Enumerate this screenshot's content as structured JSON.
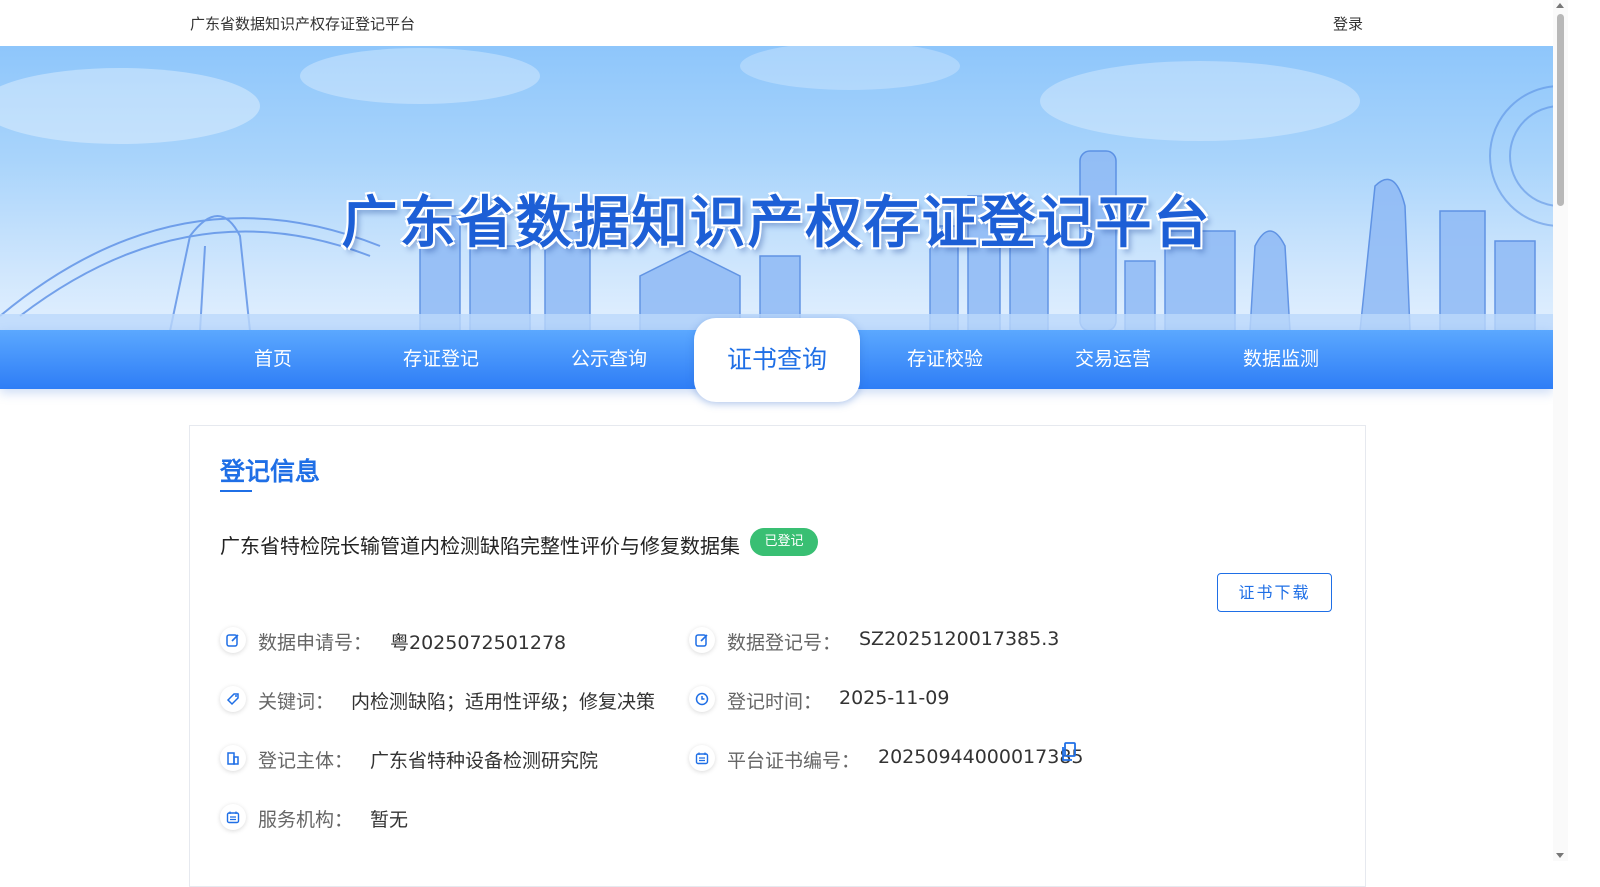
{
  "header": {
    "site_title": "广东省数据知识产权存证登记平台",
    "login_label": "登录"
  },
  "banner": {
    "title": "广东省数据知识产权存证登记平台"
  },
  "nav": {
    "items": [
      "首页",
      "存证登记",
      "公示查询",
      "证书查询",
      "存证校验",
      "交易运营",
      "数据监测"
    ],
    "active": "证书查询"
  },
  "record": {
    "section_title": "登记信息",
    "name": "广东省特检院长输管道内检测缺陷完整性评价与修复数据集",
    "status_badge": "已登记",
    "download_label": "证书下载",
    "fields": {
      "application_no_label": "数据申请号：",
      "application_no": "粤2025072501278",
      "registration_no_label": "数据登记号：",
      "registration_no": "SZ2025120017385.3",
      "keywords_label": "关键词：",
      "keywords": "内检测缺陷；适用性评级；修复决策",
      "registration_time_label": "登记时间：",
      "registration_time": "2025-11-09",
      "subject_label": "登记主体：",
      "subject": "广东省特种设备检测研究院",
      "cert_no_label": "平台证书编号：",
      "cert_no": "20250944000017385",
      "service_org_label": "服务机构：",
      "service_org": "暂无"
    }
  },
  "colors": {
    "primary": "#1f6fe6",
    "nav_top": "#5ba8ff",
    "nav_bottom": "#2e7df6",
    "badge_green": "#39bf73"
  },
  "icons": {
    "application_no": "edit-icon",
    "registration_no": "edit-icon",
    "keywords": "tag-icon",
    "registration_time": "clock-icon",
    "subject": "building-icon",
    "cert_no": "calendar-icon",
    "service_org": "calendar-icon",
    "copy": "copy-icon"
  }
}
